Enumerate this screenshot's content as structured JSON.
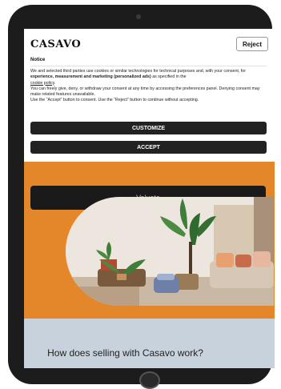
{
  "banner": {
    "logo": "CASAVO",
    "reject_label": "Reject",
    "notice_title": "Notice",
    "text": {
      "p1_start": "We and selected third parties use cookies or similar technologies for technical purposes and, with your consent, for ",
      "p1_bold": "experience, measurement and marketing (personalized ads)",
      "p1_end": " as specified in the ",
      "cookie_link": "cookie policy",
      "p1_period": ".",
      "p2": "You can freely give, deny, or withdraw your consent at any time by accessing the preferences panel. Denying consent may make related features unavailable.",
      "p3": "Use the “Accept” button to consent. Use the “Reject” button to continue without accepting."
    },
    "customize_label": "CUSTOMIZE",
    "accept_label": "ACCEPT"
  },
  "page": {
    "valuate_label": "Valuate",
    "section_title": "How does selling with Casavo work?"
  },
  "colors": {
    "accent_orange": "#e3872a",
    "dark_button": "#222222",
    "device_frame": "#1c1c1c"
  }
}
